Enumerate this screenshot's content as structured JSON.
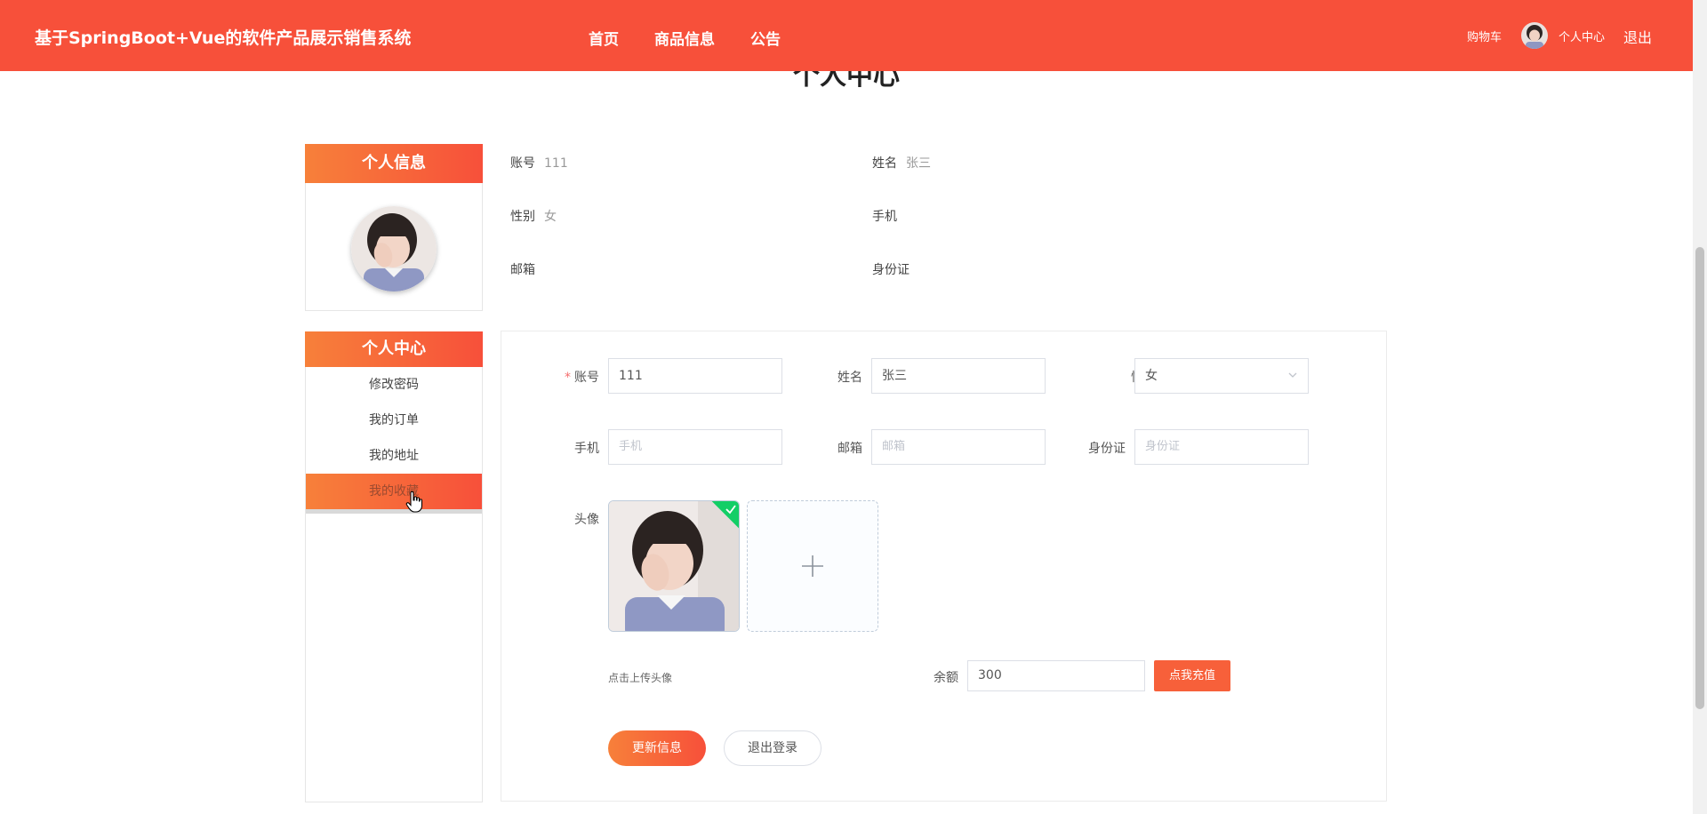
{
  "header": {
    "site_title": "基于SpringBoot+Vue的软件产品展示销售系统",
    "nav": [
      "首页",
      "商品信息",
      "公告"
    ],
    "cart_label": "购物车",
    "user_center_label": "个人中心",
    "logout_label": "退出"
  },
  "page_heading": "个人中心",
  "profile_panel": {
    "title": "个人信息",
    "fields": [
      {
        "label": "账号",
        "value": "111"
      },
      {
        "label": "姓名",
        "value": "张三"
      },
      {
        "label": "性别",
        "value": "女"
      },
      {
        "label": "手机",
        "value": ""
      },
      {
        "label": "邮箱",
        "value": ""
      },
      {
        "label": "身份证",
        "value": ""
      }
    ]
  },
  "center_panel": {
    "title": "个人中心",
    "items": [
      "修改密码",
      "我的订单",
      "我的地址",
      "我的收藏"
    ],
    "active_index": 3
  },
  "form": {
    "account": {
      "label": "账号",
      "value": "111",
      "required_mark": "*"
    },
    "name": {
      "label": "姓名",
      "value": "张三"
    },
    "gender": {
      "label": "性别",
      "value": "女"
    },
    "phone": {
      "label": "手机",
      "placeholder": "手机"
    },
    "email": {
      "label": "邮箱",
      "placeholder": "邮箱"
    },
    "idcard": {
      "label": "身份证",
      "placeholder": "身份证"
    },
    "avatar": {
      "label": "头像",
      "tip": "点击上传头像"
    },
    "balance": {
      "label": "余额",
      "value": "300",
      "recharge_label": "点我充值"
    },
    "update_label": "更新信息",
    "logout_label": "退出登录"
  },
  "colors": {
    "header_bg": "#f7503a",
    "accent_gradient_start": "#f7803a",
    "accent_gradient_end": "#f7503a",
    "success": "#13ce66"
  }
}
